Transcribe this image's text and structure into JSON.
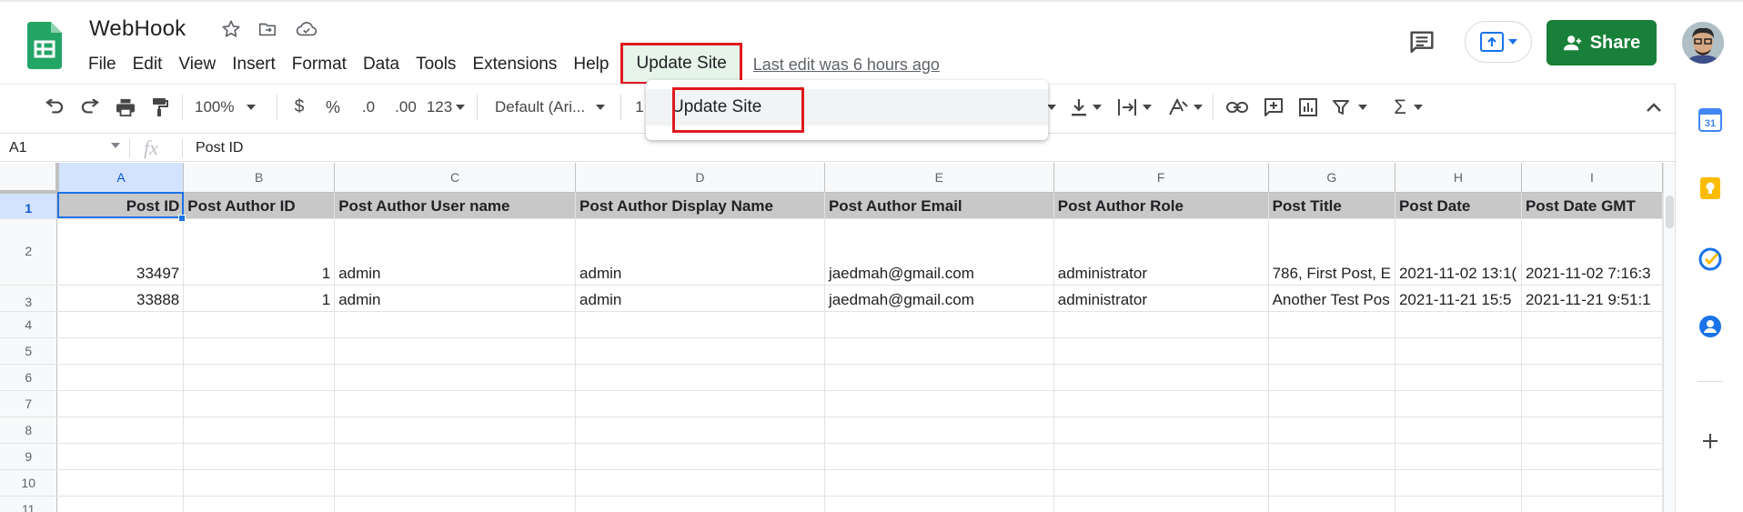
{
  "doc": {
    "title": "WebHook",
    "last_edit": "Last edit was 6 hours ago"
  },
  "menu": [
    {
      "label": "File"
    },
    {
      "label": "Edit"
    },
    {
      "label": "View"
    },
    {
      "label": "Insert"
    },
    {
      "label": "Format"
    },
    {
      "label": "Data"
    },
    {
      "label": "Tools"
    },
    {
      "label": "Extensions"
    },
    {
      "label": "Help"
    }
  ],
  "custom_menu": {
    "label": "Update Site",
    "items": [
      {
        "label": "Update Site"
      }
    ]
  },
  "share": {
    "label": "Share"
  },
  "toolbar": {
    "zoom": "100%",
    "currency": "$",
    "percent": "%",
    "decrease_decimal": ".0",
    "increase_decimal": ".00",
    "more_formats": "123",
    "font": "Default (Ari...",
    "font_size_partial": "1"
  },
  "formula_bar": {
    "cell_ref": "A1",
    "fx": "fx",
    "value": "Post ID"
  },
  "grid": {
    "columns": [
      "A",
      "B",
      "C",
      "D",
      "E",
      "F",
      "G",
      "H",
      "I"
    ],
    "row_numbers": [
      "1",
      "2",
      "3",
      "4",
      "5",
      "6",
      "7",
      "8",
      "9",
      "10",
      "11"
    ],
    "header_row": [
      "Post ID",
      "Post Author ID",
      "Post Author User name",
      "Post Author Display Name",
      "Post Author Email",
      "Post Author Role",
      "Post Title",
      "Post Date",
      "Post Date GMT"
    ],
    "data_rows": [
      [
        "33497",
        "1",
        "admin",
        "admin",
        "jaedmah@gmail.com",
        "administrator",
        "786, First Post, E",
        "2021-11-02 13:1(",
        "2021-11-02 7:16:3"
      ],
      [
        "33888",
        "1",
        "admin",
        "admin",
        "jaedmah@gmail.com",
        "administrator",
        "Another Test Pos",
        "2021-11-21 15:5",
        "2021-11-21 9:51:1"
      ]
    ]
  },
  "colors": {
    "brand_green": "#188038",
    "highlight_red": "#e0191f",
    "selection_blue": "#1a73e8",
    "header_gray": "#c8c8c8"
  },
  "icons": [
    "sheets-logo",
    "star-icon",
    "move-to-folder-icon",
    "cloud-saved-icon",
    "comment-icon",
    "present-icon",
    "person-icon",
    "undo-icon",
    "redo-icon",
    "print-icon",
    "paint-format-icon",
    "calendar-icon",
    "keep-icon",
    "tasks-icon",
    "contacts-icon",
    "plus-icon"
  ]
}
